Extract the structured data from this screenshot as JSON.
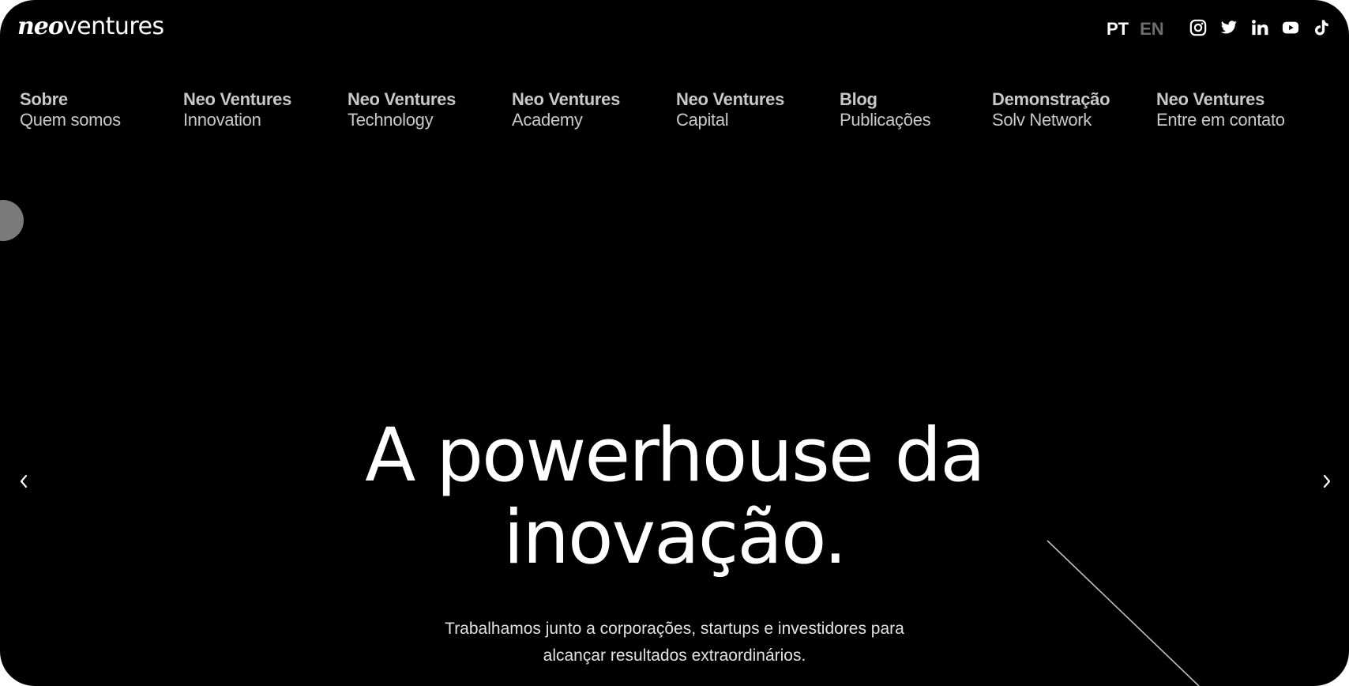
{
  "header": {
    "logo": {
      "part1": "neo",
      "part2": "ventures"
    },
    "languages": [
      "PT",
      "EN"
    ],
    "active_language": "PT",
    "socials": [
      "instagram-icon",
      "twitter-icon",
      "linkedin-icon",
      "youtube-icon",
      "tiktok-icon"
    ]
  },
  "nav": {
    "items": [
      {
        "title": "Sobre",
        "subtitle": "Quem somos"
      },
      {
        "title": "Neo Ventures",
        "subtitle": "Innovation"
      },
      {
        "title": "Neo Ventures",
        "subtitle": "Technology"
      },
      {
        "title": "Neo Ventures",
        "subtitle": "Academy"
      },
      {
        "title": "Neo Ventures",
        "subtitle": "Capital"
      },
      {
        "title": "Blog",
        "subtitle": "Publicações"
      },
      {
        "title": "Demonstração",
        "subtitle": "Solv Network"
      },
      {
        "title": "Neo Ventures",
        "subtitle": "Entre em contato"
      }
    ]
  },
  "hero": {
    "headline_line1": "A powerhouse da",
    "headline_line2": "inovação.",
    "subtext_line1": "Trabalhamos junto a corporações, startups e investidores para",
    "subtext_line2": "alcançar resultados extraordinários."
  },
  "carousel": {
    "prev_icon": "chevron-left-icon",
    "next_icon": "chevron-right-icon"
  },
  "colors": {
    "background": "#000000",
    "text": "#ffffff",
    "nav_text": "#c8c8c8",
    "inactive_language": "#6e6e6e",
    "scroll_dot": "#7a7a7a"
  }
}
